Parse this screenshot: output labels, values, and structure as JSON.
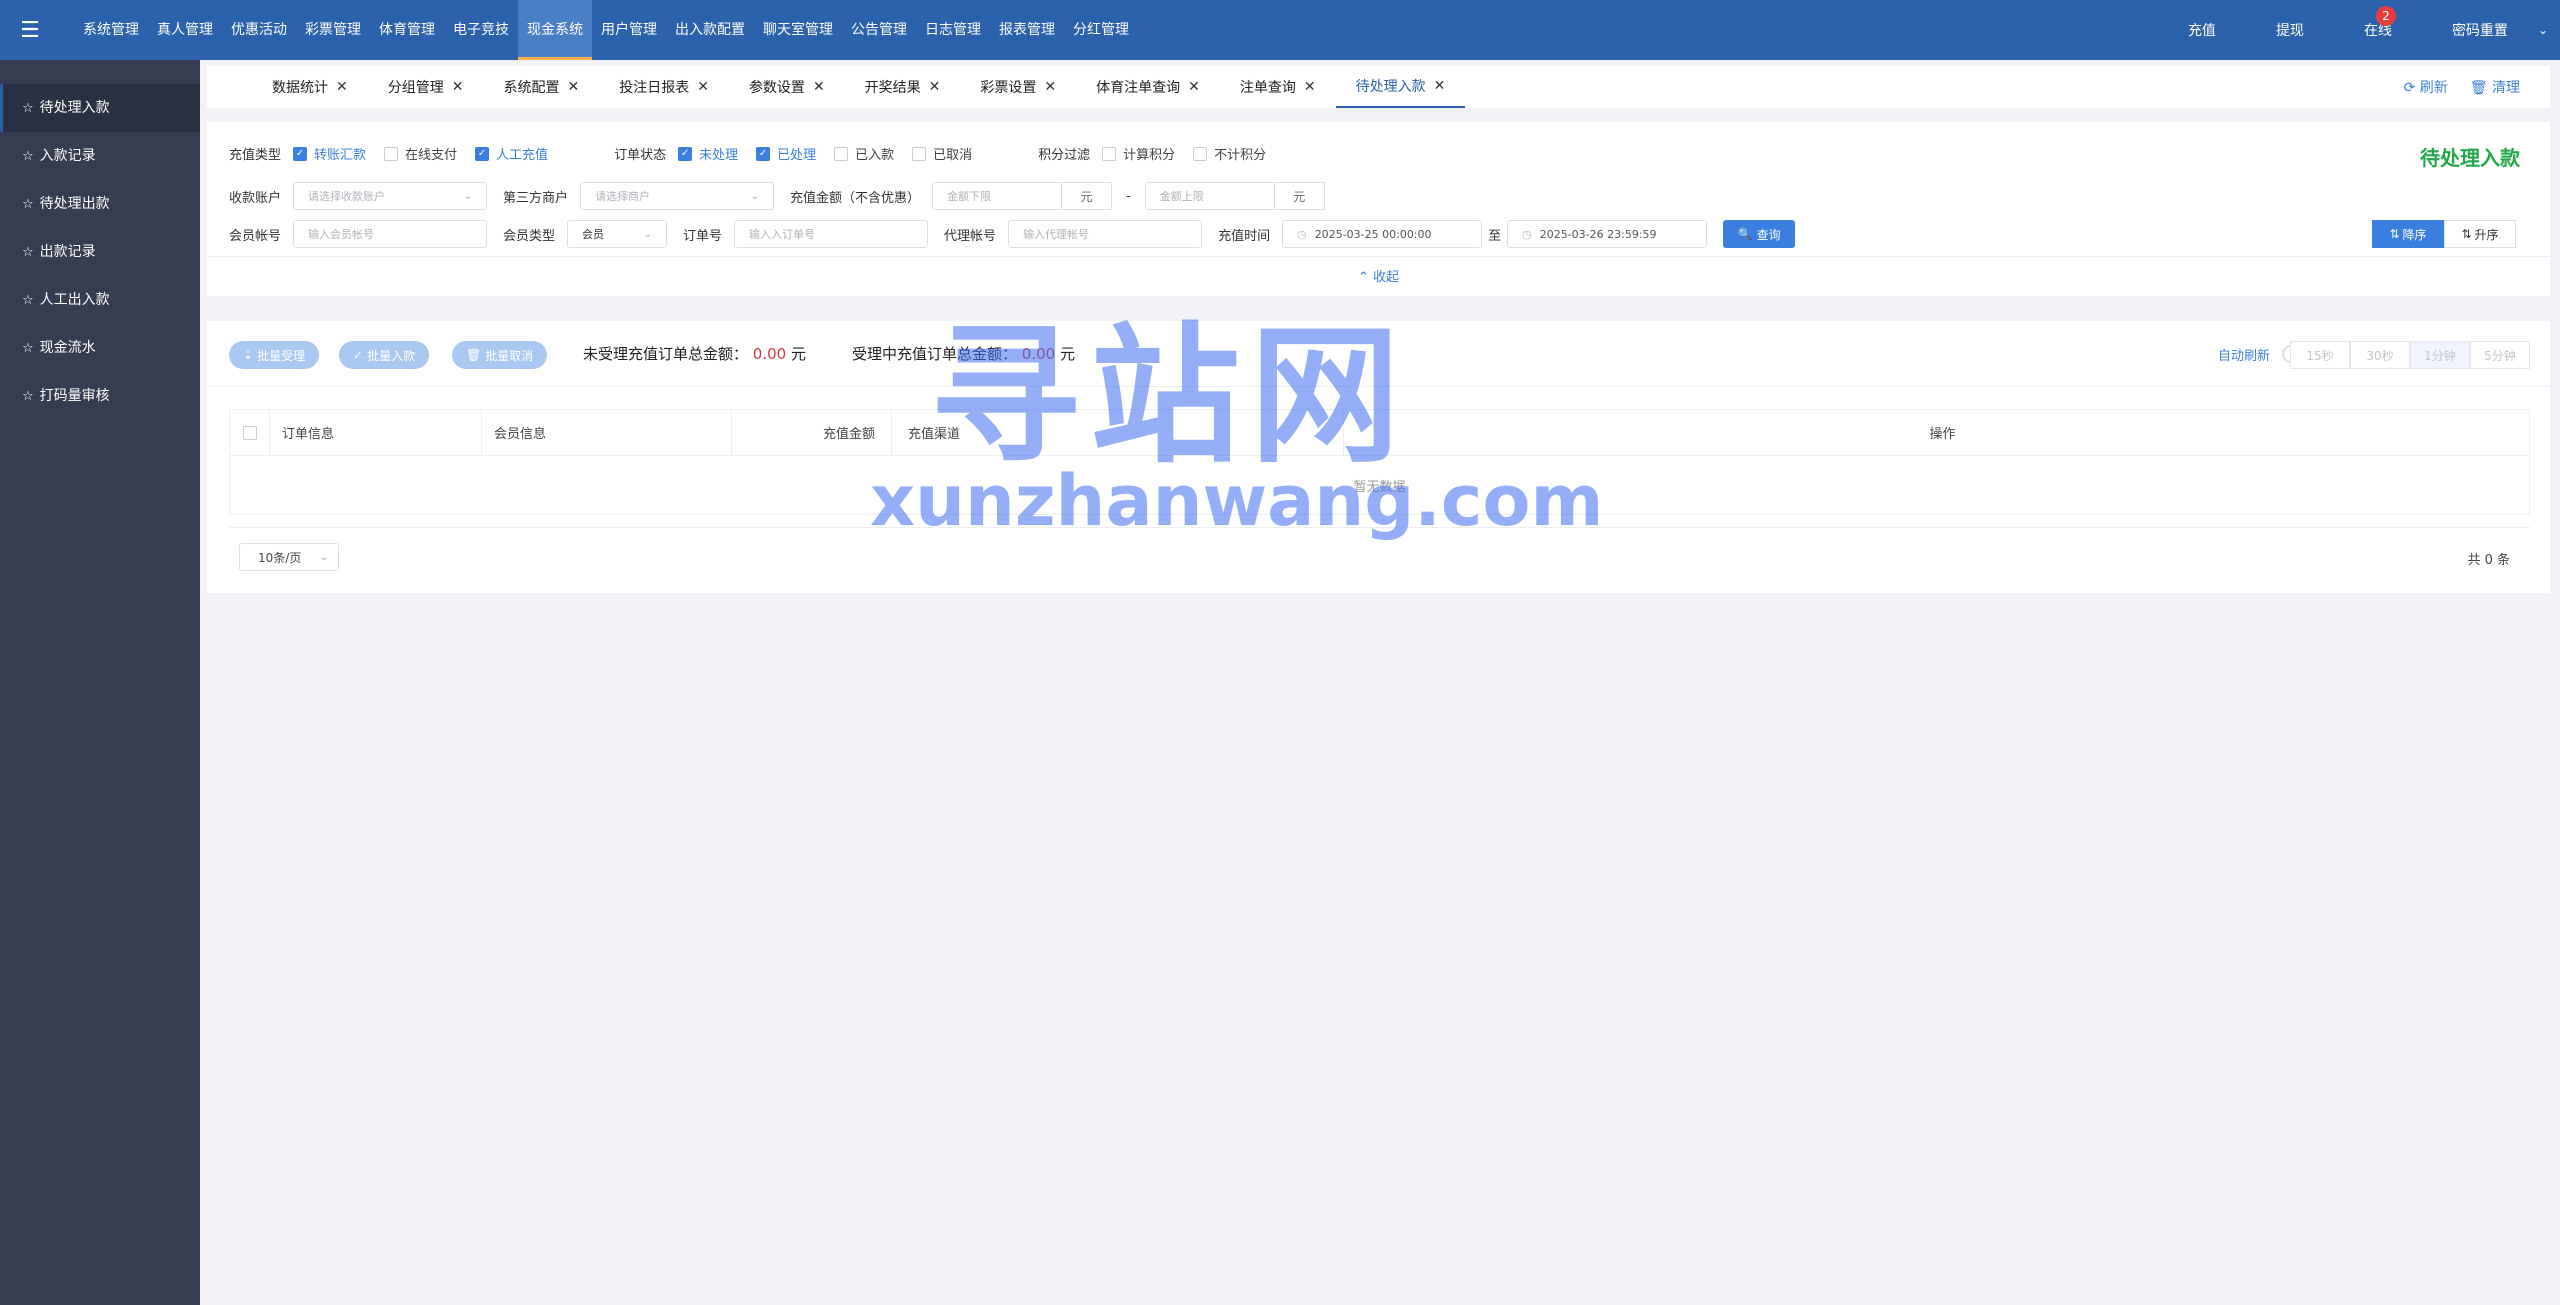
{
  "topnav": {
    "items": [
      "系统管理",
      "真人管理",
      "优惠活动",
      "彩票管理",
      "体育管理",
      "电子竞技",
      "现金系统",
      "用户管理",
      "出入款配置",
      "聊天室管理",
      "公告管理",
      "日志管理",
      "报表管理",
      "分红管理"
    ],
    "active_index": 6
  },
  "topright": {
    "recharge": "充值",
    "withdraw": "提现",
    "online": "在线",
    "online_badge": "2",
    "reset_password": "密码重置"
  },
  "sidebar": {
    "items": [
      "待处理入款",
      "入款记录",
      "待处理出款",
      "出款记录",
      "人工出入款",
      "现金流水",
      "打码量审核"
    ],
    "active_index": 0
  },
  "tabs": {
    "items": [
      "数据统计",
      "分组管理",
      "系统配置",
      "投注日报表",
      "参数设置",
      "开奖结果",
      "彩票设置",
      "体育注单查询",
      "注单查询",
      "待处理入款"
    ],
    "active_index": 9,
    "refresh": "刷新",
    "clear": "清理"
  },
  "filter": {
    "title": "待处理入款",
    "recharge_type_label": "充值类型",
    "recharge_types": [
      {
        "label": "转账汇款",
        "checked": true
      },
      {
        "label": "在线支付",
        "checked": false
      },
      {
        "label": "人工充值",
        "checked": true
      }
    ],
    "order_status_label": "订单状态",
    "order_statuses": [
      {
        "label": "未处理",
        "checked": true
      },
      {
        "label": "已处理",
        "checked": true
      },
      {
        "label": "已入款",
        "checked": false
      },
      {
        "label": "已取消",
        "checked": false
      }
    ],
    "points_label": "积分过滤",
    "points_options": [
      {
        "label": "计算积分",
        "checked": false
      },
      {
        "label": "不计积分",
        "checked": false
      }
    ],
    "receive_account_label": "收款账户",
    "receive_account_placeholder": "请选择收款账户",
    "third_merchant_label": "第三方商户",
    "third_merchant_placeholder": "请选择商户",
    "amount_label": "充值金额（不含优惠）",
    "amount_min_placeholder": "金额下限",
    "amount_max_placeholder": "金额上限",
    "unit": "元",
    "dash": "-",
    "member_account_label": "会员帐号",
    "member_account_placeholder": "输入会员帐号",
    "member_type_label": "会员类型",
    "member_type_value": "会员",
    "order_no_label": "订单号",
    "order_no_placeholder": "输入入订单号",
    "agent_account_label": "代理帐号",
    "agent_account_placeholder": "输入代理帐号",
    "recharge_time_label": "充值时间",
    "time_start": "2025-03-25 00:00:00",
    "time_to": "至",
    "time_end": "2025-03-26 23:59:59",
    "query_button": "查询",
    "sort_desc": "降序",
    "sort_asc": "升序",
    "collapse": "收起"
  },
  "results": {
    "batch_accept": "批量受理",
    "batch_deposit": "批量入款",
    "batch_cancel": "批量取消",
    "unaccepted_label": "未受理充值订单总金额：",
    "unaccepted_amount": "0.00",
    "accepting_label": "受理中充值订单总金额：",
    "accepting_amount": "0.00",
    "currency": "元",
    "auto_refresh": "自动刷新",
    "intervals": [
      "15秒",
      "30秒",
      "1分钟",
      "5分钟"
    ],
    "selected_interval_index": 2,
    "columns": [
      "订单信息",
      "会员信息",
      "充值金额",
      "充值渠道",
      "",
      "操作"
    ],
    "empty_text": "暂无数据",
    "page_size": "10条/页",
    "total": "共 0 条"
  },
  "watermark": {
    "cn": "寻站网",
    "en": "xunzhanwang.com"
  }
}
